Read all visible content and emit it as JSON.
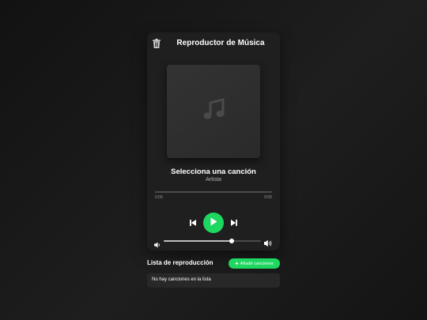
{
  "header": {
    "title": "Reproductor de Música",
    "delete_icon": "trash-icon"
  },
  "cover": {
    "icon": "music-note-icon"
  },
  "now_playing": {
    "title": "Selecciona una canción",
    "artist": "Artista"
  },
  "progress": {
    "current": "0:00",
    "total": "0:00",
    "fraction": 0
  },
  "controls": {
    "prev_icon": "skip-back-icon",
    "play_icon": "play-icon",
    "next_icon": "skip-forward-icon"
  },
  "volume": {
    "level": 0.7,
    "low_icon": "volume-low-icon",
    "high_icon": "volume-high-icon"
  },
  "playlist": {
    "title": "Lista de reproducción",
    "add_button_label": "Añadir canciones",
    "add_icon": "plus-icon",
    "empty_message": "No hay canciones en la lista"
  },
  "colors": {
    "accent": "#1ed760",
    "background": "#181818",
    "card": "#1f1f1f"
  }
}
